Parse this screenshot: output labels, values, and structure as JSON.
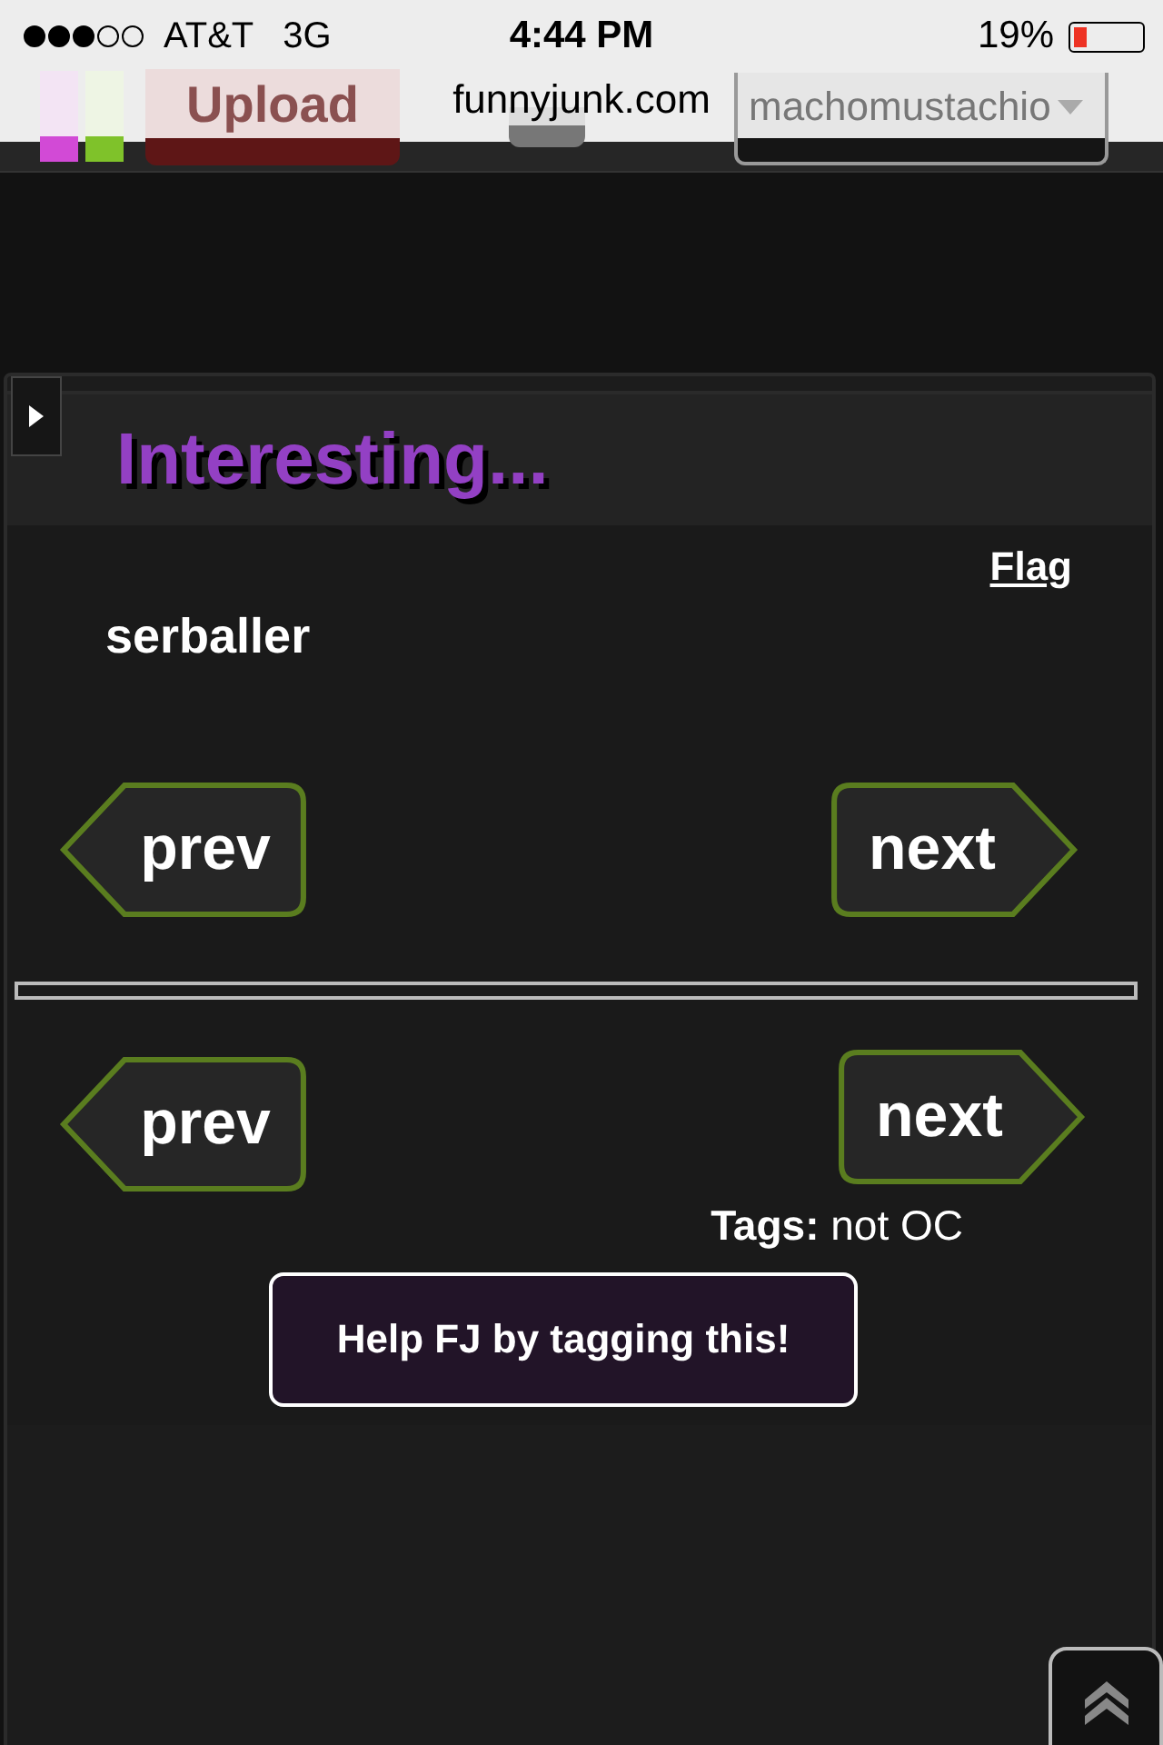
{
  "status_bar": {
    "carrier": "AT&T",
    "network": "3G",
    "time": "4:44 PM",
    "battery": "19%",
    "url": "funnyjunk.com"
  },
  "header": {
    "upload_button": "Upload",
    "user_menu": "machomustachio"
  },
  "post": {
    "title": "Interesting...",
    "flag_link": "Flag",
    "username": "serballer",
    "nav_top": [
      {
        "label": "prev",
        "kind": "back"
      },
      {
        "label": "next",
        "kind": "forward"
      }
    ],
    "nav_bottom": [
      {
        "label": "prev",
        "kind": "back"
      },
      {
        "label": "next",
        "kind": "forward"
      }
    ],
    "tags_label": "Tags:",
    "tags": "not OC",
    "help_button": "Help FJ by tagging this!"
  }
}
